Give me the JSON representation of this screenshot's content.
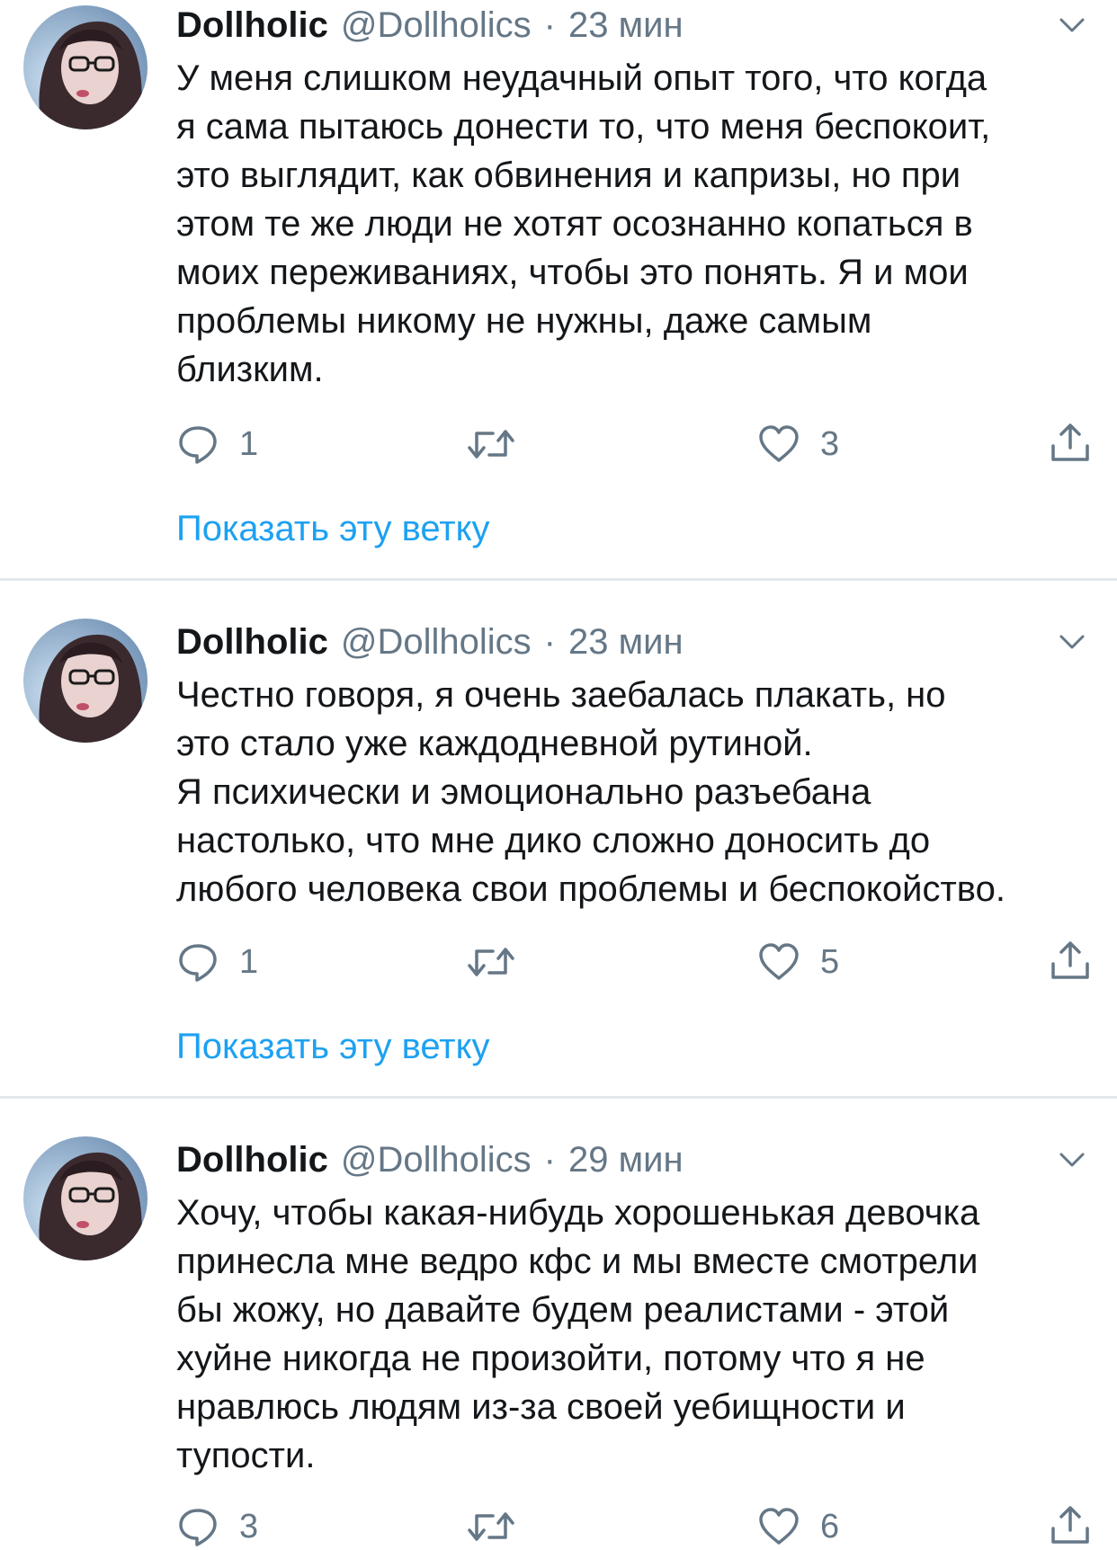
{
  "colors": {
    "accent": "#1da1f2",
    "secondary_text": "#657786",
    "primary_text": "#14171a",
    "divider": "#e1e8ed"
  },
  "icons": {
    "reply": "reply-icon",
    "retweet": "retweet-icon",
    "like": "heart-icon",
    "share": "share-icon",
    "menu": "chevron-down-icon"
  },
  "tweets": [
    {
      "display_name": "Dollholic",
      "handle": "@Dollholics",
      "separator": "·",
      "time": "23 мин",
      "text": "У меня слишком неудачный опыт того, что когда\nя сама пытаюсь донести то, что меня беспокоит,\nэто выглядит, как обвинения и капризы, но при\nэтом те же люди не хотят осознанно копаться в\nмоих переживаниях, чтобы это понять. Я и мои\nпроблемы никому не нужны, даже самым\nблизким.",
      "replies": "1",
      "likes": "3",
      "show_thread": "Показать эту ветку"
    },
    {
      "display_name": "Dollholic",
      "handle": "@Dollholics",
      "separator": "·",
      "time": "23 мин",
      "text": "Честно говоря,  я очень заебалась плакать, но\nэто стало уже каждодневной рутиной.\nЯ психически и эмоционально разъебана\nнастолько, что мне дико сложно доносить до\nлюбого человека свои проблемы и беспокойство.",
      "replies": "1",
      "likes": "5",
      "show_thread": "Показать эту ветку"
    },
    {
      "display_name": "Dollholic",
      "handle": "@Dollholics",
      "separator": "·",
      "time": "29 мин",
      "text": "Хочу, чтобы какая-нибудь хорошенькая девочка\nпринесла мне ведро кфс и мы вместе смотрели\nбы жожу, но давайте будем реалистами - этой\nхуйне никогда не произойти, потому что я не\nнравлюсь людям из-за своей уебищности и\nтупости.",
      "replies": "3",
      "likes": "6"
    }
  ]
}
